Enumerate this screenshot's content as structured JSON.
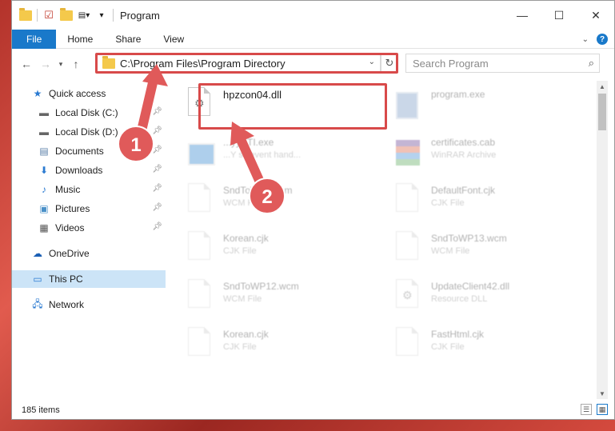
{
  "window": {
    "title": "Program",
    "controls": {
      "minimize": "—",
      "maximize": "☐",
      "close": "✕"
    }
  },
  "ribbon": {
    "tabs": [
      {
        "label": "File"
      },
      {
        "label": "Home"
      },
      {
        "label": "Share"
      },
      {
        "label": "View"
      }
    ]
  },
  "address_bar": {
    "path": "C:\\Program Files\\Program Directory"
  },
  "search": {
    "placeholder": "Search Program"
  },
  "sidebar": {
    "items": [
      {
        "label": "Quick access",
        "icon": "star-icon"
      },
      {
        "label": "Local Disk (C:)",
        "icon": "drive-icon"
      },
      {
        "label": "Local Disk (D:)",
        "icon": "drive-icon"
      },
      {
        "label": "Documents",
        "icon": "documents-icon"
      },
      {
        "label": "Downloads",
        "icon": "download-icon"
      },
      {
        "label": "Music",
        "icon": "music-icon"
      },
      {
        "label": "Pictures",
        "icon": "pictures-icon"
      },
      {
        "label": "Videos",
        "icon": "videos-icon"
      },
      {
        "label": "OneDrive",
        "icon": "cloud-icon"
      },
      {
        "label": "This PC",
        "icon": "computer-icon"
      },
      {
        "label": "Network",
        "icon": "network-icon"
      }
    ]
  },
  "files": [
    {
      "name": "hpzcon04.dll",
      "type": "",
      "icon": "dll-icon"
    },
    {
      "name": "program.exe",
      "type": "",
      "icon": "program-icon"
    },
    {
      "name": "...yySTI.exe",
      "type": "...Y sti event hand...",
      "icon": "exe-icon"
    },
    {
      "name": "certificates.cab",
      "type": "WinRAR Archive",
      "icon": "archive-icon"
    },
    {
      "name": "SndToWP...wcm",
      "type": "WCM File",
      "icon": "file-icon"
    },
    {
      "name": "DefaultFont.cjk",
      "type": "CJK File",
      "icon": "file-icon"
    },
    {
      "name": "Korean.cjk",
      "type": "CJK File",
      "icon": "file-icon"
    },
    {
      "name": "SndToWP13.wcm",
      "type": "WCM File",
      "icon": "file-icon"
    },
    {
      "name": "SndToWP12.wcm",
      "type": "WCM File",
      "icon": "file-icon"
    },
    {
      "name": "UpdateClient42.dll",
      "type": "Resource DLL",
      "icon": "dll-icon"
    },
    {
      "name": "Korean.cjk",
      "type": "CJK File",
      "icon": "file-icon"
    },
    {
      "name": "FastHtml.cjk",
      "type": "CJK File",
      "icon": "file-icon"
    }
  ],
  "status": {
    "item_count": "185 items"
  },
  "annotations": {
    "badge1": "1",
    "badge2": "2",
    "color": "#d84a4a"
  }
}
